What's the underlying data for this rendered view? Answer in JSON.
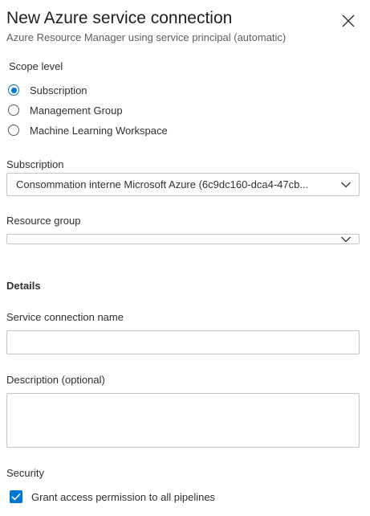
{
  "header": {
    "title": "New Azure service connection",
    "subtitle": "Azure Resource Manager using service principal (automatic)"
  },
  "scope": {
    "label": "Scope level",
    "options": [
      {
        "label": "Subscription",
        "checked": true
      },
      {
        "label": "Management Group",
        "checked": false
      },
      {
        "label": "Machine Learning Workspace",
        "checked": false
      }
    ]
  },
  "subscription": {
    "label": "Subscription",
    "value": "Consommation interne Microsoft Azure (6c9dc160-dca4-47cb..."
  },
  "resource_group": {
    "label": "Resource group",
    "value": ""
  },
  "details": {
    "heading": "Details",
    "service_connection_name_label": "Service connection name",
    "service_connection_name_value": "",
    "description_label": "Description (optional)",
    "description_value": ""
  },
  "security": {
    "heading": "Security",
    "grant_access_label": "Grant access permission to all pipelines",
    "grant_access_checked": true
  },
  "icons": {
    "close": "close-icon",
    "dropdown": "chevron-down-icon",
    "checkmark": "checkmark-icon"
  },
  "colors": {
    "accent": "#0078d4",
    "border": "#c8c6c4",
    "text": "#323130",
    "secondary_text": "#605e5c"
  }
}
